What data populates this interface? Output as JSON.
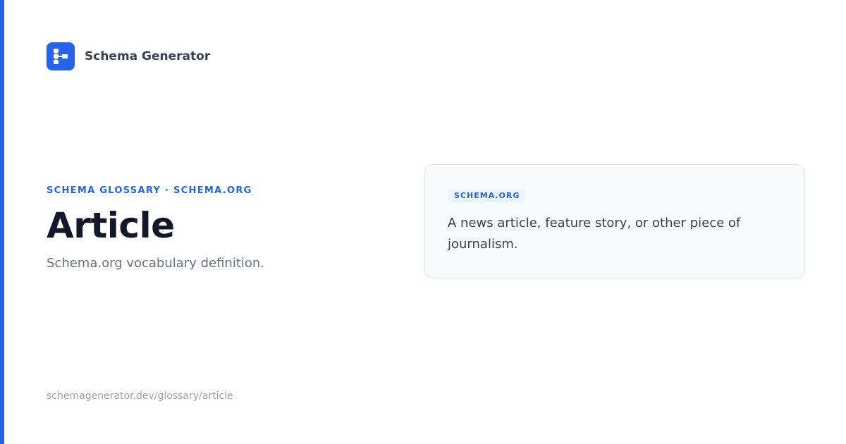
{
  "brand": {
    "name": "Schema Generator",
    "logo_icon": "schema-tree-icon"
  },
  "hero": {
    "eyebrow": "SCHEMA GLOSSARY · SCHEMA.ORG",
    "title": "Article",
    "subtitle": "Schema.org vocabulary definition."
  },
  "card": {
    "badge": "SCHEMA.ORG",
    "description": "A news article, feature story, or other piece of journalism."
  },
  "footer": {
    "url": "schemagenerator.dev/glossary/article"
  },
  "colors": {
    "accent": "#2563eb",
    "title": "#111827",
    "body_text": "#374151",
    "muted_text": "#6b7280",
    "footer_text": "#9ca3af",
    "card_background": "#f8fafc",
    "card_border": "#e5e7eb"
  }
}
